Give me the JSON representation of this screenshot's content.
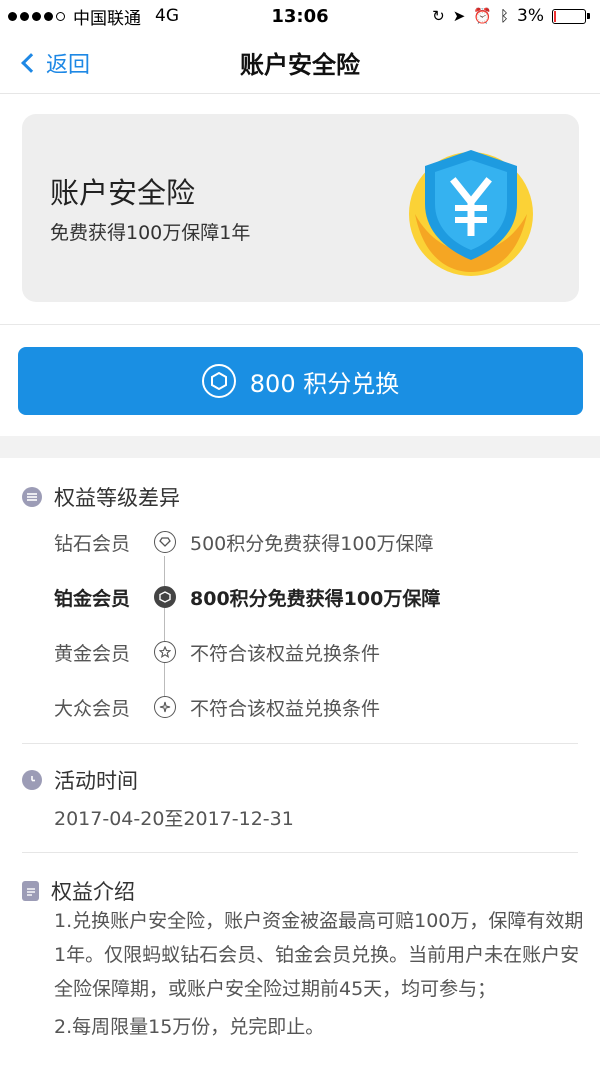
{
  "status_bar": {
    "carrier": "中国联通",
    "network": "4G",
    "time": "13:06",
    "battery": "3%",
    "battery_level": 0.03
  },
  "nav": {
    "back_label": "返回",
    "title": "账户安全险"
  },
  "card": {
    "title": "账户安全险",
    "subtitle": "免费获得100万保障1年"
  },
  "redeem_button": {
    "label": "800 积分兑换"
  },
  "tiers_section": {
    "title": "权益等级差异",
    "tiers": [
      {
        "name": "钻石会员",
        "desc": "500积分免费获得100万保障"
      },
      {
        "name": "铂金会员",
        "desc": "800积分免费获得100万保障"
      },
      {
        "name": "黄金会员",
        "desc": "不符合该权益兑换条件"
      },
      {
        "name": "大众会员",
        "desc": "不符合该权益兑换条件"
      }
    ]
  },
  "time_section": {
    "title": "活动时间",
    "date_range": "2017-04-20至2017-12-31"
  },
  "intro_section": {
    "title": "权益介绍",
    "paragraphs": [
      "1.兑换账户安全险，账户资金被盗最高可赔100万，保障有效期1年。仅限蚂蚁钻石会员、铂金会员兑换。当前用户未在账户安全险保障期，或账户安全险过期前45天，均可参与；",
      "2.每周限量15万份，兑完即止。"
    ]
  },
  "colors": {
    "accent": "#1a8fe3",
    "back_link": "#1e88e5",
    "shield": "#1e9be0",
    "hands": "#f5a623"
  }
}
